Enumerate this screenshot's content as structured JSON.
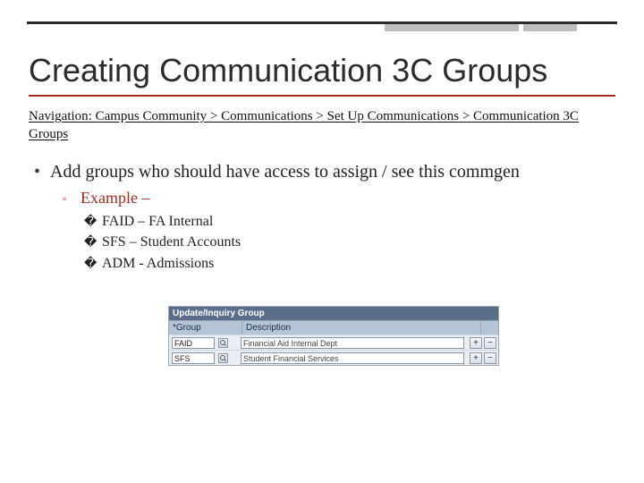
{
  "title": "Creating Communication 3C Groups",
  "navigation": "Navigation: Campus Community > Communications  > Set Up Communications > Communication 3C Groups",
  "bullets": {
    "b1": "Add groups who should have access to assign / see this commgen",
    "b2": "Example –",
    "items": [
      "FAID – FA Internal",
      "SFS – Student Accounts",
      "ADM - Admissions"
    ]
  },
  "screenshot": {
    "panel_title": "Update/Inquiry Group",
    "col_group_label": "Group",
    "col_desc_label": "Description",
    "rows": [
      {
        "group": "FAID",
        "desc": "Financial Aid Internal Dept"
      },
      {
        "group": "SFS",
        "desc": "Student Financial Services"
      }
    ],
    "minus": "−",
    "plus": "+"
  }
}
